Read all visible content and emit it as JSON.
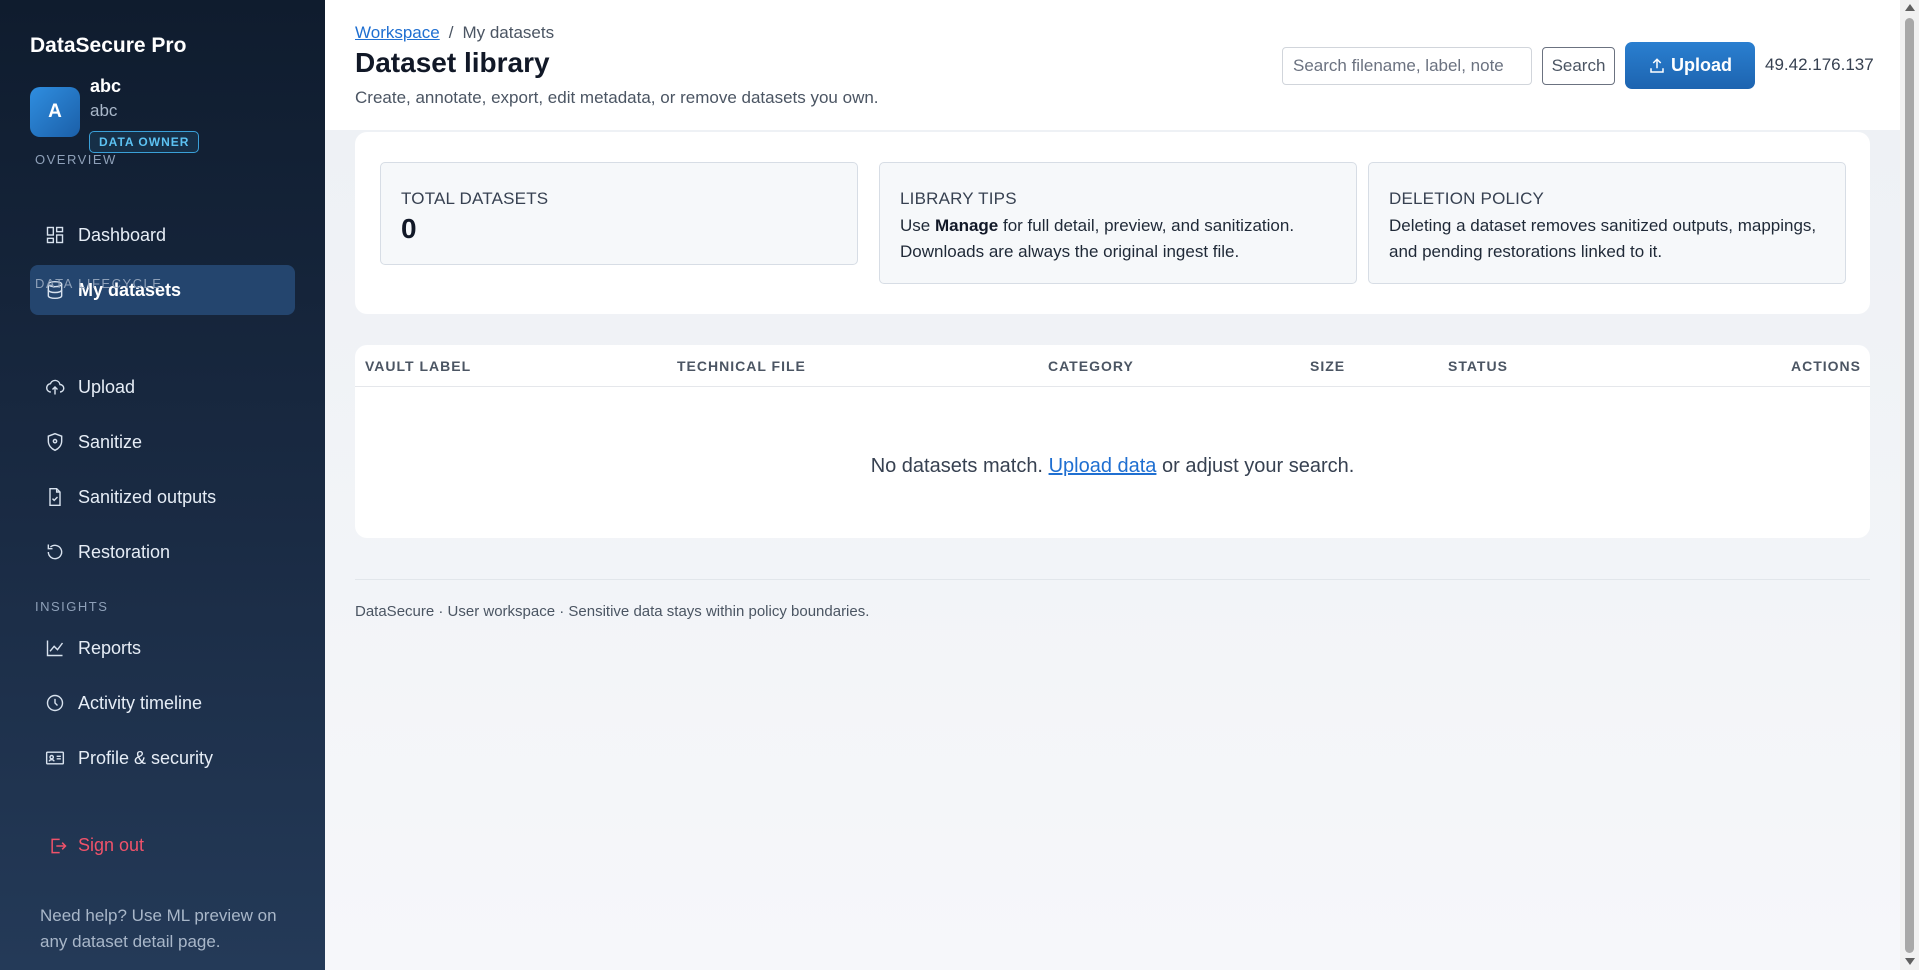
{
  "app": {
    "brand": "DataSecure Pro",
    "user_initial": "A",
    "user_name": "abc",
    "user_sub": "abc",
    "role": "DATA OWNER"
  },
  "sidebar": {
    "sections": [
      {
        "label": "OVERVIEW"
      },
      {
        "label": "DATA LIFECYCLE"
      },
      {
        "label": "INSIGHTS"
      }
    ],
    "items": [
      {
        "label": "Dashboard",
        "icon": "dashboard-icon"
      },
      {
        "label": "My datasets",
        "icon": "database-icon",
        "active": true
      },
      {
        "label": "Upload",
        "icon": "cloud-upload-icon"
      },
      {
        "label": "Sanitize",
        "icon": "shield-icon"
      },
      {
        "label": "Sanitized outputs",
        "icon": "file-check-icon"
      },
      {
        "label": "Restoration",
        "icon": "restore-icon"
      },
      {
        "label": "Reports",
        "icon": "chart-line-icon"
      },
      {
        "label": "Activity timeline",
        "icon": "clock-icon"
      },
      {
        "label": "Profile & security",
        "icon": "id-card-icon"
      }
    ],
    "sign_out": "Sign out",
    "help": "Need help? Use ML preview on any dataset detail page."
  },
  "header": {
    "breadcrumb_root": "Workspace",
    "breadcrumb_sep": "/",
    "breadcrumb_current": "My datasets",
    "title": "Dataset library",
    "subtitle": "Create, annotate, export, edit metadata, or remove datasets you own.",
    "search_placeholder": "Search filename, label, note",
    "search_value": "",
    "search_button": "Search",
    "upload_button": "Upload",
    "ip": "49.42.176.137"
  },
  "stats": {
    "total_label": "TOTAL DATASETS",
    "total_value": "0",
    "tips_label": "LIBRARY TIPS",
    "tips_pre": "Use ",
    "tips_bold": "Manage",
    "tips_post": " for full detail, preview, and sanitization. Downloads are always the original ingest file.",
    "deletion_label": "DELETION POLICY",
    "deletion_text": "Deleting a dataset removes sanitized outputs, mappings, and pending restorations linked to it."
  },
  "table": {
    "columns": [
      "VAULT LABEL",
      "TECHNICAL FILE",
      "CATEGORY",
      "SIZE",
      "STATUS",
      "ACTIONS"
    ],
    "empty_pre": "No datasets match. ",
    "empty_link": "Upload data",
    "empty_post": " or adjust your search."
  },
  "footer": "DataSecure · User workspace · Sensitive data stays within policy boundaries.",
  "colors": {
    "sidebar_bg": "#0f1c2e",
    "accent": "#1f6fd1",
    "active_nav": "#24456e",
    "danger": "#f0526a",
    "badge": "#5cc2f2"
  }
}
